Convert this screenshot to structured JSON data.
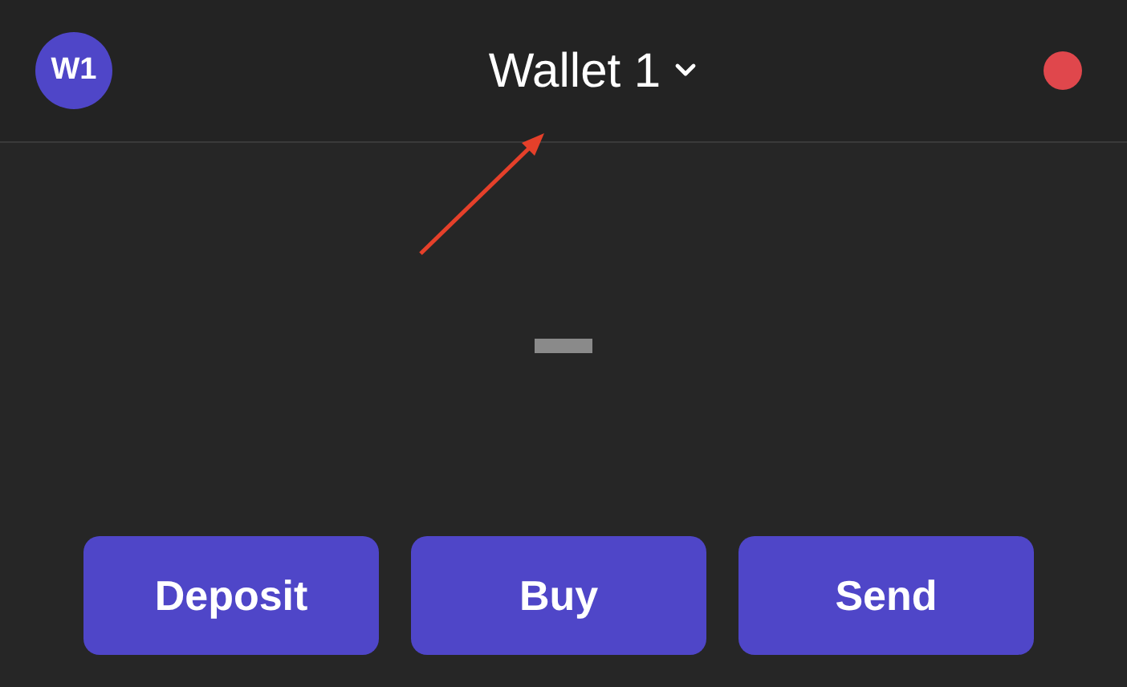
{
  "header": {
    "avatar": "W1",
    "title": "Wallet 1"
  },
  "actions": [
    {
      "label": "Deposit"
    },
    {
      "label": "Buy"
    },
    {
      "label": "Send"
    }
  ]
}
